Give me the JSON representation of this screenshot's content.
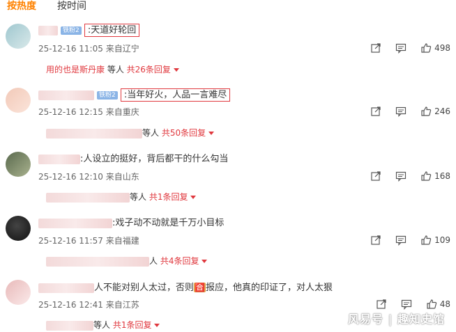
{
  "tabs": [
    {
      "label": "按热度"
    },
    {
      "label": "按时间"
    }
  ],
  "comments": [
    {
      "text": ":天道好轮回",
      "timestamp": "25-12-16 11:05",
      "location": "来自辽宁",
      "likes": "498",
      "badge": "铁粉2",
      "replies": {
        "user": "用的也是斯丹康",
        "mid": " 等人 ",
        "count": "共26条回复"
      }
    },
    {
      "text": ":当年好火，人品一言难尽",
      "timestamp": "25-12-16 12:15",
      "location": "来自重庆",
      "likes": "246",
      "badge": "铁粉2",
      "replies": {
        "user": "",
        "mid": "等人 ",
        "count": "共50条回复"
      }
    },
    {
      "text": ":人设立的挺好，背后都干的什么勾当",
      "timestamp": "25-12-16 12:10",
      "location": "来自山东",
      "likes": "168",
      "replies": {
        "user": "",
        "mid": "等人 ",
        "count": "共1条回复"
      }
    },
    {
      "text": ":戏子动不动就是千万小目标",
      "timestamp": "25-12-16 11:57",
      "location": "来自福建",
      "likes": "109",
      "replies": {
        "user": "",
        "mid": "人 ",
        "count": "共4条回复"
      }
    },
    {
      "text_part1": "人不能对别人太过，否则",
      "emoji": "🈴",
      "text_part2": "报应，他真的印证了，对人太狠",
      "timestamp": "25-12-16 12:41",
      "location": "来自江苏",
      "likes": "48",
      "replies": {
        "user": "",
        "mid": "等人 ",
        "count": "共1条回复"
      }
    }
  ],
  "watermark": "风易号 | 趣知史馆",
  "icons": {
    "share": "share-icon",
    "comment": "comment-icon",
    "like": "thumb-up-icon"
  }
}
